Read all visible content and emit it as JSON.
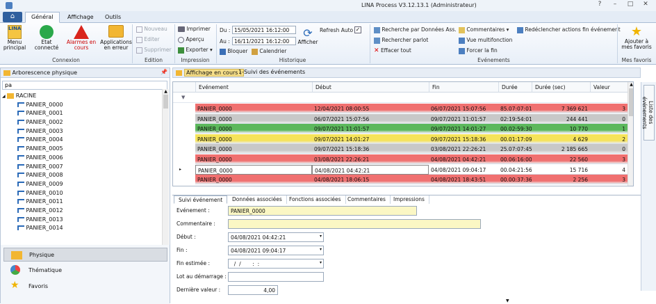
{
  "window": {
    "title": "LINA Process  V3.12.13.1  (Administrateur)",
    "buttons": [
      "?",
      "–",
      "□",
      "✕"
    ]
  },
  "tabs": [
    "Général",
    "Affichage",
    "Outils"
  ],
  "ribbon": {
    "connexion": {
      "label": "Connexion",
      "menu": "Menu principal",
      "etat": "Etat connecté",
      "alarmes": "Alarmes en cours",
      "applis": "Applications en erreur"
    },
    "edition": {
      "label": "Edition",
      "nouveau": "Nouveau",
      "editer": "Editer",
      "supprimer": "Supprimer"
    },
    "impression": {
      "label": "Impression",
      "imprimer": "Imprimer",
      "apercu": "Aperçu",
      "exporter": "Exporter"
    },
    "historique": {
      "label": "Historique",
      "du_label": "Du :",
      "du_value": "15/05/2021 16:12:00",
      "au_label": "Au :",
      "au_value": "16/11/2021 16:12:00",
      "bloquer": "Bloquer",
      "calendrier": "Calendrier",
      "refresh": "Refresh Auto",
      "afficher": "Afficher"
    },
    "evenements": {
      "label": "Evénements",
      "recherche_donnees": "Recherche par Données Ass.",
      "recherche_parlot": "Rechercher parlot",
      "effacer": "Effacer tout",
      "commentaires": "Commentaires",
      "vue_multi": "Vue multifonction",
      "forcer_fin": "Forcer la fin",
      "redeclencher": "Redéclencher actions fin événement"
    },
    "favoris": {
      "label": "Mes favoris",
      "ajouter": "Ajouter à mes favoris"
    }
  },
  "left": {
    "title": "Arborescence physique",
    "search_value": "pa",
    "root": "RACINE",
    "items": [
      "PANIER_0000",
      "PANIER_0001",
      "PANIER_0002",
      "PANIER_0003",
      "PANIER_0004",
      "PANIER_0005",
      "PANIER_0006",
      "PANIER_0007",
      "PANIER_0008",
      "PANIER_0009",
      "PANIER_0010",
      "PANIER_0011",
      "PANIER_0012",
      "PANIER_0013",
      "PANIER_0014"
    ],
    "nav": [
      "Physique",
      "Thématique",
      "Favoris"
    ]
  },
  "right": {
    "affichage_label": "Affichage en cours :",
    "affichage_value": "1-Suivi des événements",
    "sidebar_label": "Liste des événements"
  },
  "grid": {
    "columns": [
      "Evénement",
      "Début",
      "Fin",
      "Durée",
      "Durée (sec)",
      "Valeur"
    ],
    "rows": [
      {
        "ev": "PANIER_0000",
        "debut": "12/04/2021 08:00:55",
        "fin": "06/07/2021 15:07:56",
        "duree": "85.07:07:01",
        "sec": "7 369 621",
        "val": "3",
        "color": "#f07070"
      },
      {
        "ev": "PANIER_0000",
        "debut": "06/07/2021 15:07:56",
        "fin": "09/07/2021 11:01:57",
        "duree": "02:19:54:01",
        "sec": "244 441",
        "val": "0",
        "color": "#c8c8c8"
      },
      {
        "ev": "PANIER_0000",
        "debut": "09/07/2021 11:01:57",
        "fin": "09/07/2021 14:01:27",
        "duree": "00.02:59:30",
        "sec": "10 770",
        "val": "1",
        "color": "#5cb85c"
      },
      {
        "ev": "PANIER_0000",
        "debut": "09/07/2021 14:01:27",
        "fin": "09/07/2021 15:18:36",
        "duree": "00.01:17:09",
        "sec": "4 629",
        "val": "2",
        "color": "#f5e35a"
      },
      {
        "ev": "PANIER_0000",
        "debut": "09/07/2021 15:18:36",
        "fin": "03/08/2021 22:26:21",
        "duree": "25.07:07:45",
        "sec": "2 185 665",
        "val": "0",
        "color": "#c8c8c8"
      },
      {
        "ev": "PANIER_0000",
        "debut": "03/08/2021 22:26:21",
        "fin": "04/08/2021 04:42:21",
        "duree": "00.06:16:00",
        "sec": "22 560",
        "val": "3",
        "color": "#f07070"
      },
      {
        "ev": "PANIER_0000",
        "debut": "04/08/2021 04:42:21",
        "fin": "04/08/2021 09:04:17",
        "duree": "00.04:21:56",
        "sec": "15 716",
        "val": "4",
        "color": "#ffffff"
      },
      {
        "ev": "PANIER_0000",
        "debut": "04/08/2021 18:06:15",
        "fin": "04/08/2021 18:43:51",
        "duree": "00.00:37:36",
        "sec": "2 256",
        "val": "3",
        "color": "#f07070"
      }
    ]
  },
  "detail": {
    "tabs": [
      "Suivi événement",
      "Données associées",
      "Fonctions associées",
      "Commentaires",
      "Impressions"
    ],
    "evenement_label": "Evénement :",
    "evenement_value": "PANIER_0000",
    "commentaire_label": "Commentaire :",
    "commentaire_value": "",
    "debut_label": "Début :",
    "debut_value": "04/08/2021 04:42:21",
    "fin_label": "Fin :",
    "fin_value": "04/08/2021 09:04:17",
    "fin_estimee_label": "Fin estimée :",
    "fin_estimee_value": "  /  /       :  :",
    "lot_label": "Lot au démarrage :",
    "lot_value": "",
    "derniere_label": "Dernière valeur :",
    "derniere_value": "4,00"
  }
}
